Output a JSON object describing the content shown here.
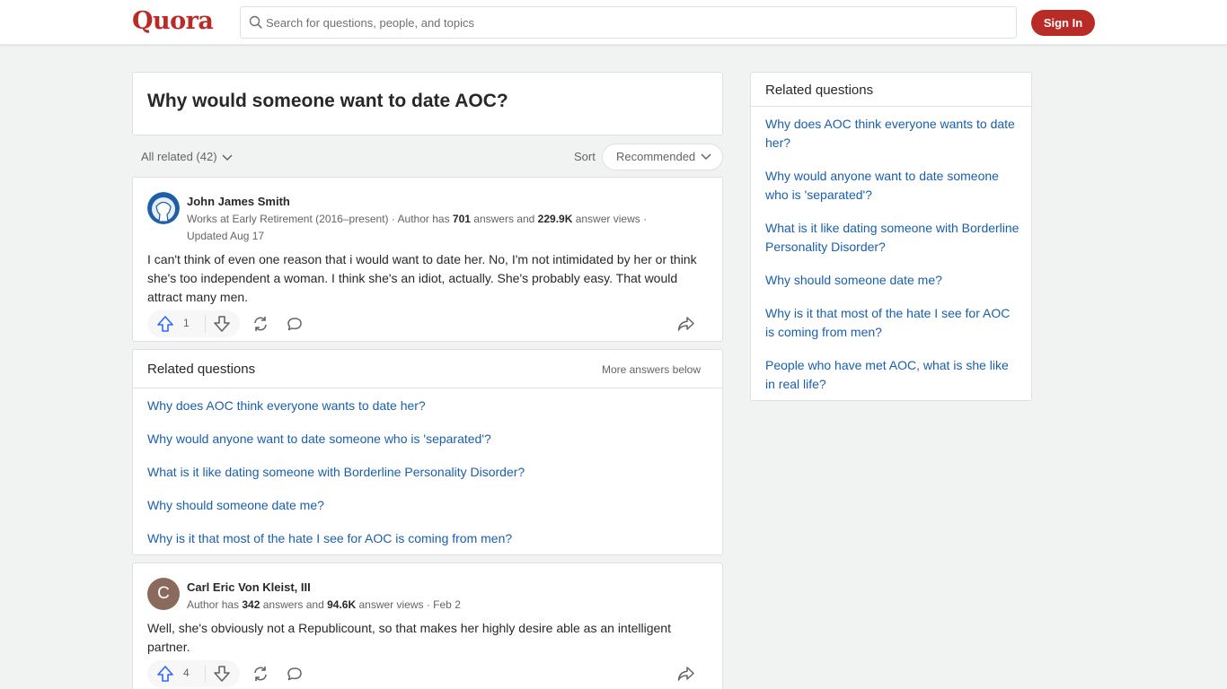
{
  "header": {
    "logo": "Quora",
    "search_placeholder": "Search for questions, people, and topics",
    "signin_label": "Sign In"
  },
  "question": {
    "title": "Why would someone want to date AOC?"
  },
  "filters": {
    "all_related": "All related (42)",
    "sort_label": "Sort",
    "sort_value": "Recommended"
  },
  "answers": [
    {
      "author": "John James Smith",
      "cred_prefix": "Works at Early Retirement (2016–present) · Author has ",
      "answers_count": "701",
      "cred_mid": " answers and ",
      "views_count": "229.9K",
      "cred_suffix": " answer views · Updated Aug 17",
      "text": "I can't think of even one reason that i would want to date her. No, I'm not intimidated by her or think she's too independent a woman. I think she's an idiot, actually. She's probably easy. That would attract many men.",
      "upvotes": "1"
    },
    {
      "author": "Carl Eric Von Kleist, III",
      "avatar_letter": "C",
      "cred_prefix": "Author has ",
      "answers_count": "342",
      "cred_mid": " answers and ",
      "views_count": "94.6K",
      "cred_suffix": " answer views · Feb 2",
      "text": "Well, she's obviously not a Republicount, so that makes her highly desire able as an intelligent partner.",
      "upvotes": "4"
    }
  ],
  "inline_related": {
    "title": "Related questions",
    "more": "More answers below",
    "items": [
      "Why does AOC think everyone wants to date her?",
      "Why would anyone want to date someone who is 'separated'?",
      "What is it like dating someone with Borderline Personality Disorder?",
      "Why should someone date me?",
      "Why is it that most of the hate I see for AOC is coming from men?"
    ]
  },
  "sidebar": {
    "title": "Related questions",
    "items": [
      "Why does AOC think everyone wants to date her?",
      "Why would anyone want to date someone who is 'separated'?",
      "What is it like dating someone with Borderline Personality Disorder?",
      "Why should someone date me?",
      "Why is it that most of the hate I see for AOC is coming from men?",
      "People who have met AOC, what is she like in real life?"
    ]
  },
  "colors": {
    "brand": "#b92b27",
    "link": "#195faa",
    "upvote": "#2e69ff",
    "background": "#f1f2f2"
  },
  "icons": [
    "search-icon",
    "chevron-down-icon",
    "upvote-icon",
    "downvote-icon",
    "share-icon",
    "comment-icon",
    "forward-icon"
  ]
}
